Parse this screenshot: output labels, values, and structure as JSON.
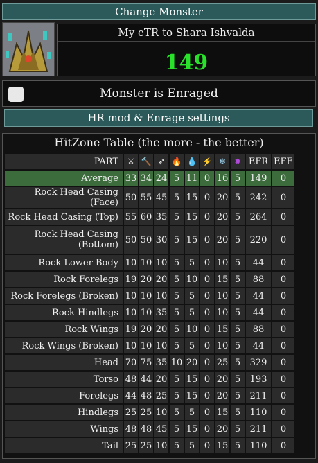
{
  "header": {
    "change_monster_label": "Change Monster"
  },
  "build": {
    "title": "My eTR to Shara Ishvalda",
    "efr_value": "149"
  },
  "enraged": {
    "label": "Monster is Enraged",
    "checked": false
  },
  "hr_settings_label": "HR mod & Enrage settings",
  "hitzone": {
    "title": "HitZone Table (the more - the better)",
    "columns": [
      {
        "label": "PART"
      },
      {
        "icon": "sever-icon",
        "glyph": "⚔"
      },
      {
        "icon": "blunt-icon",
        "glyph": "🔨"
      },
      {
        "icon": "shot-icon",
        "glyph": "➶"
      },
      {
        "icon": "fire-icon",
        "glyph": "🔥",
        "color": "#e8542a"
      },
      {
        "icon": "water-icon",
        "glyph": "💧",
        "color": "#4ab0e8"
      },
      {
        "icon": "thunder-icon",
        "glyph": "⚡",
        "color": "#f2d72a"
      },
      {
        "icon": "ice-icon",
        "glyph": "❄",
        "color": "#9fd6f2"
      },
      {
        "icon": "dragon-icon",
        "glyph": "✹",
        "color": "#b04ad8"
      },
      {
        "label": "EFR"
      },
      {
        "label": "EFE"
      }
    ],
    "rows": [
      {
        "part": "Average",
        "vals": [
          "33",
          "34",
          "24",
          "5",
          "11",
          "0",
          "16",
          "5",
          "149",
          "0"
        ],
        "avg": true
      },
      {
        "part": "Rock Head Casing (Face)",
        "vals": [
          "50",
          "55",
          "45",
          "5",
          "15",
          "0",
          "20",
          "5",
          "242",
          "0"
        ]
      },
      {
        "part": "Rock Head Casing (Top)",
        "vals": [
          "55",
          "60",
          "35",
          "5",
          "15",
          "0",
          "20",
          "5",
          "264",
          "0"
        ]
      },
      {
        "part": "Rock Head Casing (Bottom)",
        "vals": [
          "50",
          "50",
          "30",
          "5",
          "15",
          "0",
          "20",
          "5",
          "220",
          "0"
        ],
        "tall": true
      },
      {
        "part": "Rock Lower Body",
        "vals": [
          "10",
          "10",
          "10",
          "5",
          "5",
          "0",
          "10",
          "5",
          "44",
          "0"
        ]
      },
      {
        "part": "Rock Forelegs",
        "vals": [
          "19",
          "20",
          "20",
          "5",
          "10",
          "0",
          "15",
          "5",
          "88",
          "0"
        ]
      },
      {
        "part": "Rock Forelegs (Broken)",
        "vals": [
          "10",
          "10",
          "10",
          "5",
          "5",
          "0",
          "10",
          "5",
          "44",
          "0"
        ]
      },
      {
        "part": "Rock Hindlegs",
        "vals": [
          "10",
          "10",
          "35",
          "5",
          "5",
          "0",
          "10",
          "5",
          "44",
          "0"
        ]
      },
      {
        "part": "Rock Wings",
        "vals": [
          "19",
          "20",
          "20",
          "5",
          "10",
          "0",
          "15",
          "5",
          "88",
          "0"
        ]
      },
      {
        "part": "Rock Wings (Broken)",
        "vals": [
          "10",
          "10",
          "10",
          "5",
          "5",
          "0",
          "10",
          "5",
          "44",
          "0"
        ]
      },
      {
        "part": "Head",
        "vals": [
          "70",
          "75",
          "35",
          "10",
          "20",
          "0",
          "25",
          "5",
          "329",
          "0"
        ]
      },
      {
        "part": "Torso",
        "vals": [
          "48",
          "44",
          "20",
          "5",
          "15",
          "0",
          "20",
          "5",
          "193",
          "0"
        ]
      },
      {
        "part": "Forelegs",
        "vals": [
          "44",
          "48",
          "25",
          "5",
          "15",
          "0",
          "20",
          "5",
          "211",
          "0"
        ]
      },
      {
        "part": "Hindlegs",
        "vals": [
          "25",
          "25",
          "10",
          "5",
          "5",
          "0",
          "15",
          "5",
          "110",
          "0"
        ]
      },
      {
        "part": "Wings",
        "vals": [
          "48",
          "48",
          "45",
          "5",
          "15",
          "0",
          "20",
          "5",
          "211",
          "0"
        ]
      },
      {
        "part": "Tail",
        "vals": [
          "25",
          "25",
          "10",
          "5",
          "5",
          "0",
          "15",
          "5",
          "110",
          "0"
        ]
      }
    ]
  }
}
